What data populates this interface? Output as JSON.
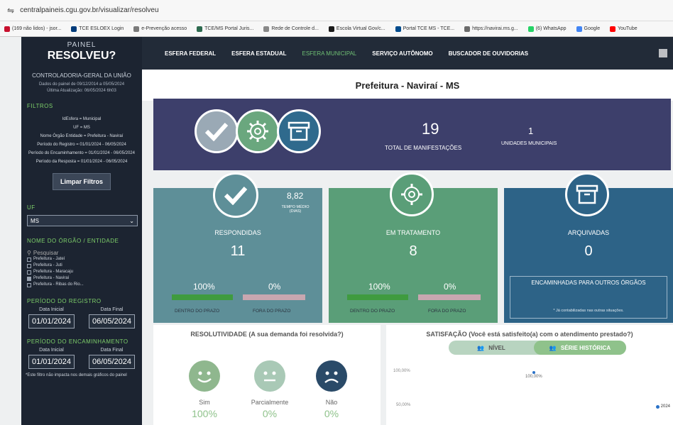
{
  "browser": {
    "url": "centralpaineis.cgu.gov.br/visualizar/resolveu",
    "bookmarks": [
      {
        "label": "(169 não lidos) - jsor...",
        "color": "#c8102e"
      },
      {
        "label": "TCE ESLOEX Login",
        "color": "#003b7a"
      },
      {
        "label": "e-Prevenção acesso",
        "color": "#7a7a7a"
      },
      {
        "label": "TCE/MS Portal Juris...",
        "color": "#2d6a4f"
      },
      {
        "label": "Rede de Controle d...",
        "color": "#888888"
      },
      {
        "label": "Escola Virtual Gov/c...",
        "color": "#1a1a1a"
      },
      {
        "label": "Portal TCE MS - TCE...",
        "color": "#004b8d"
      },
      {
        "label": "https://navirai.ms.g...",
        "color": "#6b6b6b"
      },
      {
        "label": "(6) WhatsApp",
        "color": "#25d366"
      },
      {
        "label": "Google",
        "color": "#4285f4"
      },
      {
        "label": "YouTube",
        "color": "#ff0000"
      }
    ]
  },
  "sidebar": {
    "painel": "PAINEL",
    "resolveu": "RESOLVEU?",
    "org": "CONTROLADORIA-GERAL DA UNIÃO",
    "dados": "Dados do painel de 09/12/2014 a 05/05/2024",
    "atualizacao": "Última Atualização: 06/05/2024 6h03",
    "filtros_head": "FILTROS",
    "filtros": [
      "IdEsfera = Municipal",
      "UF = MS",
      "Nome Órgão Entidade = Prefeitura - Naviraí",
      "Período do Registro = 01/01/2024 - 06/05/2024",
      "Período do Encaminhamento = 01/01/2024 - 06/05/2024",
      "Período da Resposta = 01/01/2024 - 06/05/2024"
    ],
    "limpar": "Limpar Filtros",
    "uf_head": "UF",
    "uf_value": "MS",
    "orgao_head": "NOME DO ÓRGÃO / ENTIDADE",
    "search_placeholder": "Pesquisar",
    "orgaos": [
      {
        "label": "Prefeitura - Jateí",
        "checked": false
      },
      {
        "label": "Prefeitura - Juti",
        "checked": false
      },
      {
        "label": "Prefeitura - Maracaju",
        "checked": false
      },
      {
        "label": "Prefeitura - Naviraí",
        "checked": true
      },
      {
        "label": "Prefeitura - Ribas do Rio...",
        "checked": false
      }
    ],
    "registro_head": "PERÍODO DO REGISTRO",
    "encaminhamento_head": "PERÍODO DO ENCAMINHAMENTO",
    "data_inicial": "Data Inicial",
    "data_final": "Data Final",
    "registro_inicio": "01/01/2024",
    "registro_fim": "06/05/2024",
    "enc_inicio": "01/01/2024",
    "enc_fim": "06/05/2024",
    "nota": "*Este filtro não impacta nos demais gráficos do painel"
  },
  "nav": {
    "tabs": [
      "ESFERA FEDERAL",
      "ESFERA ESTADUAL",
      "ESFERA MUNICIPAL",
      "SERVIÇO AUTÔNOMO",
      "BUSCADOR DE OUVIDORIAS"
    ],
    "active": "ESFERA MUNICIPAL"
  },
  "place": "Prefeitura - Naviraí - MS",
  "summary": {
    "total": "19",
    "total_label": "TOTAL DE MANIFESTAÇÕES",
    "unidades": "1",
    "unidades_label": "UNIDADES MUNICIPAIS"
  },
  "respondidas": {
    "title": "RESPONDIDAS",
    "value": "11",
    "tempo": "8,82",
    "tempo_label": "TEMPO MÉDIO (DIAS)",
    "dentro_pct": "100%",
    "fora_pct": "0%",
    "dentro_label": "DENTRO DO PRAZO",
    "fora_label": "FORA DO PRAZO"
  },
  "tratamento": {
    "title": "EM TRATAMENTO",
    "value": "8",
    "dentro_pct": "100%",
    "fora_pct": "0%",
    "dentro_label": "DENTRO DO PRAZO",
    "fora_label": "FORA DO PRAZO"
  },
  "arquivadas": {
    "title": "ARQUIVADAS",
    "value": "0",
    "encaminhadas": "ENCAMINHADAS PARA OUTROS ÓRGÃOS",
    "nota": "* Já contabilizadas nas outras situações."
  },
  "resolutividade": {
    "title": "RESOLUTIVIDADE (A sua demanda foi resolvida?)",
    "items": [
      {
        "label": "Sim",
        "pct": "100%"
      },
      {
        "label": "Parcialmente",
        "pct": "0%"
      },
      {
        "label": "Não",
        "pct": "0%"
      }
    ]
  },
  "satisfacao": {
    "title": "SATISFAÇÃO (Você está satisfeito(a) com o atendimento prestado?)",
    "nivel": "NÍVEL",
    "serie": "SÉRIE HISTÓRICA",
    "y100": "100,00%",
    "y50": "50,00%",
    "point_label": "100,00%",
    "legend": "2024"
  },
  "colors": {
    "sidebar": "#1c2431",
    "summary": "#3d3f6b",
    "respondidas": "#5e8f98",
    "tratamento": "#5a9e78",
    "arquivadas": "#2d6387",
    "green": "#6fbf73"
  }
}
